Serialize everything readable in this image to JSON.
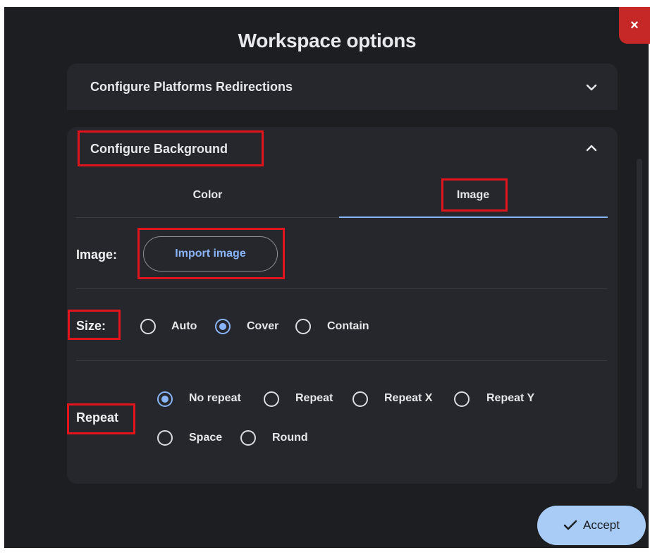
{
  "dialog": {
    "title": "Workspace options",
    "close_label": "×"
  },
  "sections": {
    "platforms": {
      "header": "Configure Platforms Redirections",
      "expanded": false
    },
    "background": {
      "header": "Configure Background",
      "expanded": true
    }
  },
  "tabs": [
    {
      "label": "Color",
      "active": false
    },
    {
      "label": "Image",
      "active": true
    }
  ],
  "image_row": {
    "label": "Image:",
    "import_button": "Import image"
  },
  "size": {
    "label": "Size:",
    "options": [
      "Auto",
      "Cover",
      "Contain"
    ],
    "selected": "Cover"
  },
  "repeat": {
    "label": "Repeat",
    "options": [
      "No repeat",
      "Repeat",
      "Repeat X",
      "Repeat Y",
      "Space",
      "Round"
    ],
    "selected": "No repeat"
  },
  "footer": {
    "accept_label": "Accept"
  },
  "colors": {
    "accent": "#8ab4f8",
    "highlight": "#e0141c",
    "close": "#c62828",
    "accept_bg": "#a8ccf6"
  }
}
